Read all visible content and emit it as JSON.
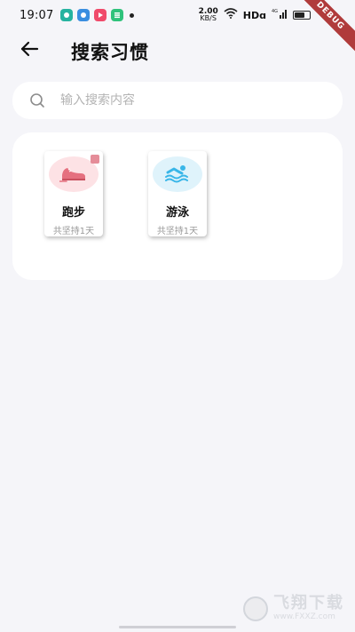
{
  "status_bar": {
    "time": "19:07",
    "net_speed_value": "2.00",
    "net_speed_unit": "KB/S",
    "network_label": "HDɑ",
    "cell_label": "4G",
    "battery_level": 0.6
  },
  "debug_banner": "DEBUG",
  "header": {
    "title": "搜索习惯"
  },
  "search": {
    "placeholder": "输入搜索内容",
    "value": ""
  },
  "habits": [
    {
      "name": "跑步",
      "days": "共坚持1天",
      "icon": "running-shoe-icon",
      "icon_bg": "#fde2e5",
      "icon_color": "#e5707f"
    },
    {
      "name": "游泳",
      "days": "共坚持1天",
      "icon": "swimming-icon",
      "icon_bg": "#dff3fb",
      "icon_color": "#39b6e8"
    }
  ],
  "watermark": {
    "text": "飞翔下载",
    "url": "www.FXXZ.com"
  },
  "colors": {
    "background": "#f5f5f9",
    "panel": "#ffffff",
    "placeholder": "#b3b3b3"
  }
}
